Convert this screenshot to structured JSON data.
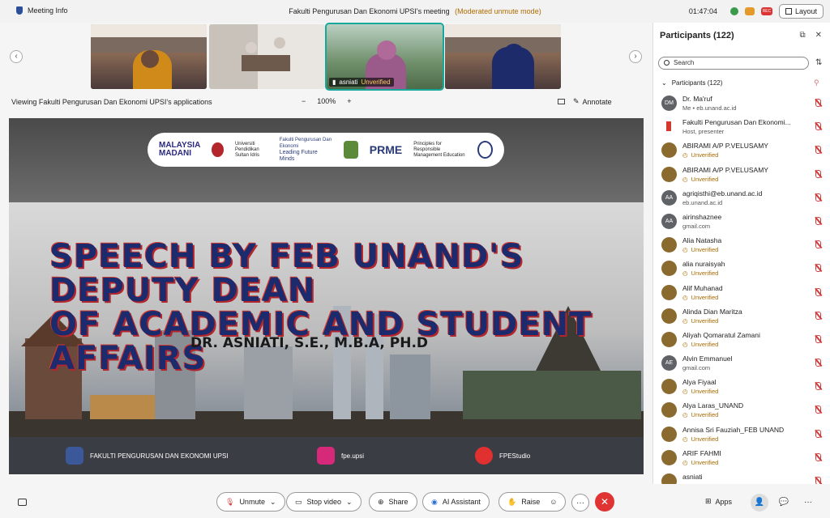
{
  "topbar": {
    "meeting_info": "Meeting Info",
    "title": "Fakulti Pengurusan Dan Ekonomi UPSI's meeting",
    "mode": "(Moderated unmute mode)",
    "time": "01:47:04",
    "rec_badge": "REC",
    "layout_label": "Layout"
  },
  "thumbnails": [
    {
      "name": "",
      "unverified": ""
    },
    {
      "name": "",
      "unverified": ""
    },
    {
      "name": "asniati",
      "unverified": "Unverified"
    },
    {
      "name": "",
      "unverified": ""
    }
  ],
  "viewbar": {
    "viewing": "Viewing Fakulti Pengurusan Dan Ekonomi UPSI's applications",
    "zoom_minus": "−",
    "zoom": "100%",
    "zoom_plus": "+",
    "annotate": "Annotate"
  },
  "slide": {
    "logo_malaysia": "MALAYSIA",
    "logo_madani": "MADANI",
    "logo_upsi": "Universiti Pendidikan Sultan Idris",
    "logo_fpe": "Fakulti Pengurusan Dan Ekonomi",
    "logo_fpe_tag": "Leading Future Minds",
    "logo_prme": "PRME",
    "logo_prme_text": "Principles for Responsible Management Education",
    "headline_1": "SPEECH BY FEB UNAND'S DEPUTY DEAN",
    "headline_2": "OF ACADEMIC AND STUDENT AFFAIRS",
    "speaker": "DR. ASNIATI, S.E., M.B.A, PH.D",
    "facebook": "FAKULTI PENGURUSAN DAN EKONOMI UPSI",
    "instagram": "fpe.upsi",
    "youtube": "FPEStudio"
  },
  "participants": {
    "title": "Participants (122)",
    "search_placeholder": "Search",
    "list_header": "Participants (122)",
    "items": [
      {
        "initials": "DM",
        "name": "Dr. Ma'ruf",
        "sub": "Me  •  eb.unand.ac.id",
        "type": "grey"
      },
      {
        "initials": "",
        "name": "Fakulti Pengurusan Dan Ekonomi...",
        "sub": "Host, presenter",
        "type": "logo"
      },
      {
        "initials": "",
        "name": "ABIRAMI A/P P.VELUSAMY",
        "sub": "Unverified",
        "type": "unv"
      },
      {
        "initials": "",
        "name": "ABIRAMI A/P P.VELUSAMY",
        "sub": "Unverified",
        "type": "unv"
      },
      {
        "initials": "AA",
        "name": "agriqisthi@eb.unand.ac.id",
        "sub": "eb.unand.ac.id",
        "type": "grey"
      },
      {
        "initials": "AA",
        "name": "airinshaznee",
        "sub": "gmail.com",
        "type": "grey"
      },
      {
        "initials": "",
        "name": "Alia Natasha",
        "sub": "Unverified",
        "type": "unv"
      },
      {
        "initials": "",
        "name": "alia nuraisyah",
        "sub": "Unverified",
        "type": "unv"
      },
      {
        "initials": "",
        "name": "Alif Muhanad",
        "sub": "Unverified",
        "type": "unv"
      },
      {
        "initials": "",
        "name": "Alinda Dian Maritza",
        "sub": "Unverified",
        "type": "unv"
      },
      {
        "initials": "",
        "name": "Aliyah Qomaratul Zamani",
        "sub": "Unverified",
        "type": "unv"
      },
      {
        "initials": "AE",
        "name": "Alvin Emmanuel",
        "sub": "gmail.com",
        "type": "grey"
      },
      {
        "initials": "",
        "name": "Alya Fiyaal",
        "sub": "Unverified",
        "type": "unv"
      },
      {
        "initials": "",
        "name": "Alya Laras_UNAND",
        "sub": "Unverified",
        "type": "unv"
      },
      {
        "initials": "",
        "name": "Annisa Sri Fauziah_FEB UNAND",
        "sub": "Unverified",
        "type": "unv"
      },
      {
        "initials": "",
        "name": "ARIF FAHMI",
        "sub": "Unverified",
        "type": "unv"
      },
      {
        "initials": "",
        "name": "asniati",
        "sub": "",
        "type": "unv"
      }
    ]
  },
  "bottombar": {
    "unmute": "Unmute",
    "stop_video": "Stop video",
    "share": "Share",
    "ai_assistant": "AI Assistant",
    "raise": "Raise",
    "more": "···",
    "end": "✕",
    "apps": "Apps"
  },
  "colors": {
    "accent_teal": "#16a89a",
    "end_red": "#e03434",
    "unverified": "#a56a00",
    "mute_red": "#d03b3b"
  }
}
